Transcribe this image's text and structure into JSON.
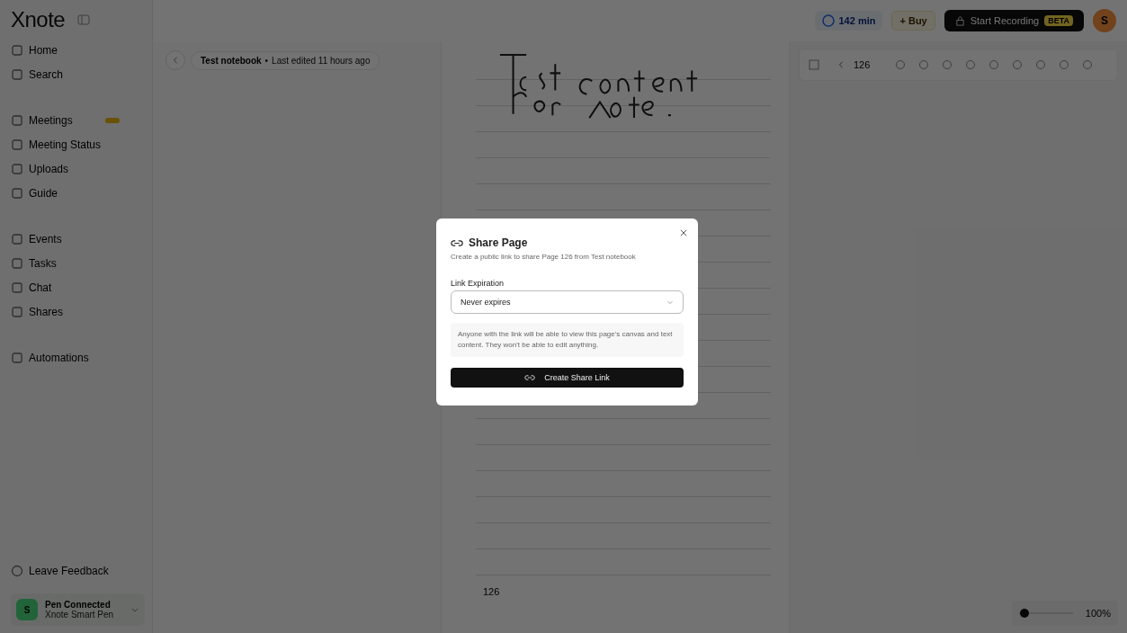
{
  "app": {
    "logo": "Xnote"
  },
  "sidebar": {
    "items": [
      {
        "label": "Home",
        "badge": false
      },
      {
        "label": "Search",
        "badge": false
      },
      {
        "label": "Meetings",
        "badge": true
      },
      {
        "label": "Meeting Status",
        "badge": false
      },
      {
        "label": "Uploads",
        "badge": false
      },
      {
        "label": "Guide",
        "badge": false
      },
      {
        "label": "Events",
        "badge": false
      },
      {
        "label": "Tasks",
        "badge": false
      },
      {
        "label": "Chat",
        "badge": false
      },
      {
        "label": "Shares",
        "badge": false
      },
      {
        "label": "Automations",
        "badge": false
      }
    ],
    "feedback": "Leave Feedback",
    "pen": {
      "status": "Pen Connected",
      "name": "Xnote Smart Pen",
      "initial": "S"
    }
  },
  "topbar": {
    "usage": "142 min",
    "buy": "+ Buy",
    "record": "Start Recording",
    "record_badge": "BETA",
    "avatar": "S"
  },
  "breadcrumb": {
    "notebook": "Test notebook",
    "separator": "•",
    "edited": "Last edited 11 hours ago"
  },
  "toolbar": {
    "page": "126"
  },
  "page": {
    "number": "126"
  },
  "zoom": {
    "level": 0.1,
    "reading": "100%"
  },
  "dialog": {
    "title": "Share Page",
    "subtitle": "Create a public link to share Page 126 from Test notebook",
    "field_label": "Link Expiration",
    "select_value": "Never expires",
    "info": "Anyone with the link will be able to view this page's canvas and text content. They won't be able to edit anything.",
    "button": "Create Share Link"
  }
}
